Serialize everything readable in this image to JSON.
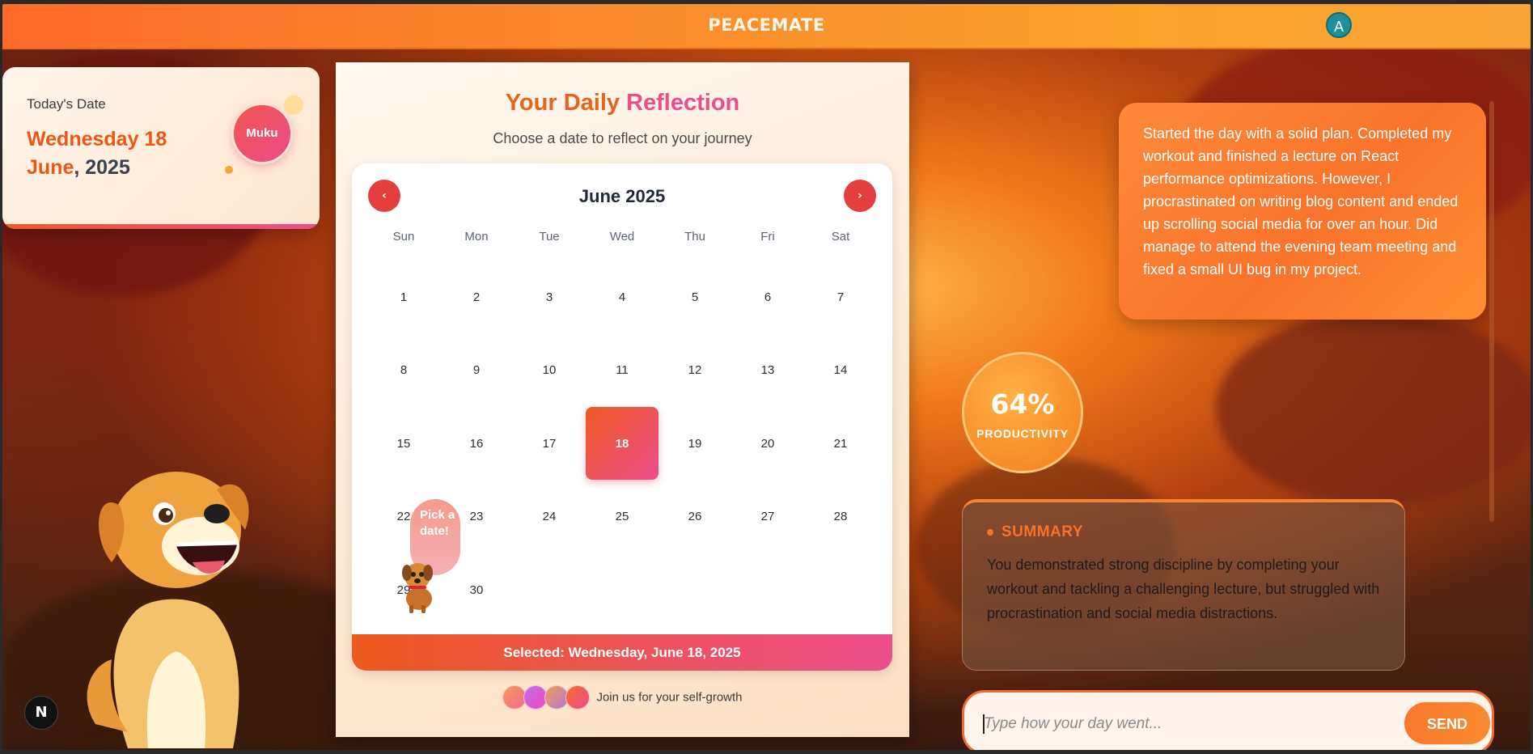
{
  "brand": {
    "part1": "PEACE",
    "part2": "MATE"
  },
  "user": {
    "avatar_letter": "A"
  },
  "date_card": {
    "label": "Today's Date",
    "weekday_day": "Wednesday 18",
    "month": "June",
    "year_suffix": ", 2025",
    "badge": "Muku"
  },
  "calendar": {
    "title_part1": "Your Daily",
    "title_part2": "Reflection",
    "subtitle": "Choose a date to reflect on your journey",
    "prev_icon": "‹",
    "next_icon": "›",
    "month_label": "June 2025",
    "weekdays": [
      "Sun",
      "Mon",
      "Tue",
      "Wed",
      "Thu",
      "Fri",
      "Sat"
    ],
    "days": [
      "1",
      "2",
      "3",
      "4",
      "5",
      "6",
      "7",
      "8",
      "9",
      "10",
      "11",
      "12",
      "13",
      "14",
      "15",
      "16",
      "17",
      "18",
      "19",
      "20",
      "21",
      "22",
      "23",
      "24",
      "25",
      "26",
      "27",
      "28",
      "29",
      "30"
    ],
    "selected_day": "18",
    "selected_text": "Selected: Wednesday, June 18, 2025",
    "pick_bubble": "Pick a date!",
    "join_text": "Join us for your self-growth"
  },
  "journal": {
    "entry": "Started the day with a solid plan. Completed my workout and finished a lecture on React performance optimizations. However, I procrastinated on writing blog content and ended up scrolling social media for over an hour. Did manage to attend the evening team meeting and fixed a small UI bug in my project."
  },
  "productivity": {
    "value": "64%",
    "label": "PRODUCTIVITY"
  },
  "summary": {
    "heading": "SUMMARY",
    "text": "You demonstrated strong discipline by completing your workout and tackling a challenging lecture, but struggled with procrastination and social media distractions."
  },
  "composer": {
    "placeholder": "Type how your day went...",
    "send_label": "SEND"
  },
  "next_badge": "N",
  "colors": {
    "accent_orange": "#ef5a23",
    "accent_pink": "#ec4d8c",
    "nav_red": "#e53e3e",
    "summary_orange": "#f4742b"
  }
}
